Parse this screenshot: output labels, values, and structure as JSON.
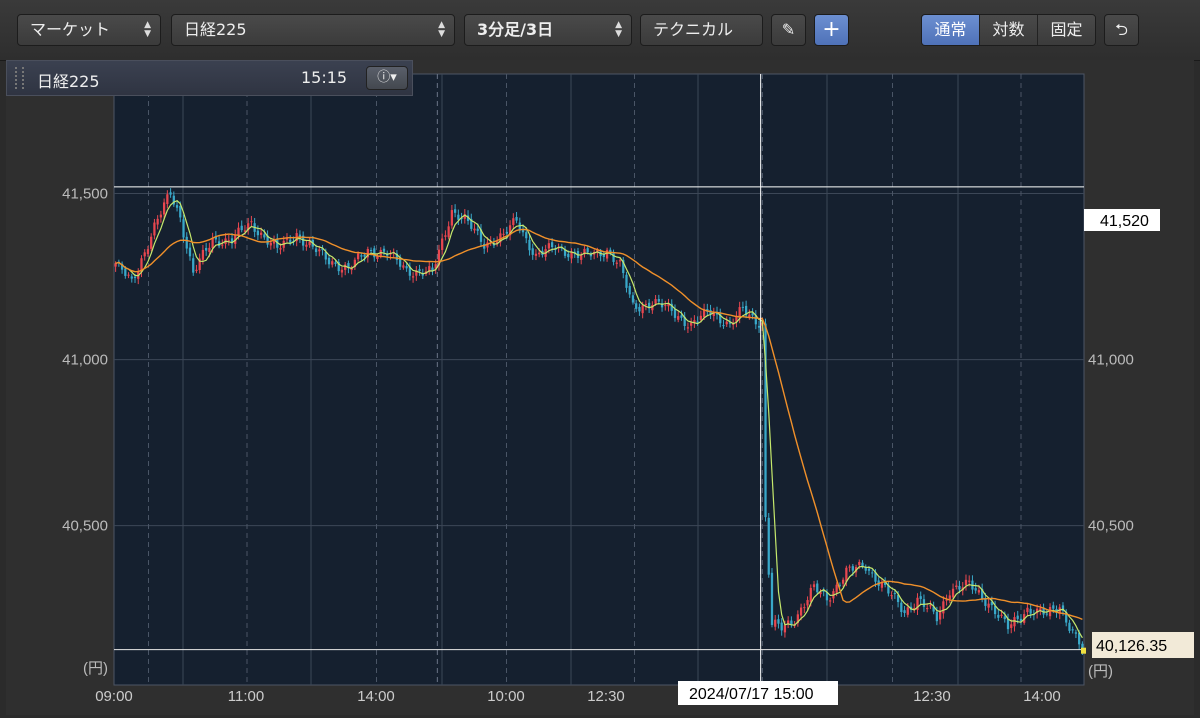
{
  "toolbar": {
    "market_label": "マーケット",
    "symbol_label": "日経225",
    "interval_label": "3分足/3日",
    "technical_label": "テクニカル",
    "scale_modes": [
      "通常",
      "対数",
      "固定"
    ],
    "active_scale_mode": "通常"
  },
  "info_panel": {
    "symbol": "日経225",
    "time": "15:15"
  },
  "crosshair": {
    "date_label": "2024/07/17 15:00",
    "price_label": "41,520",
    "price": 41520
  },
  "last_price": {
    "label": "40,126.35",
    "value": 40126.35
  },
  "unit_label": "(円)",
  "colors": {
    "background": "#15202f",
    "up": "#e8474f",
    "down": "#39a8c9",
    "ma_short": "#c5e86c",
    "ma_long": "#f0902a",
    "crosshair": "#ffffff",
    "last_marker": "#f0e040"
  },
  "chart_data": {
    "type": "candlestick",
    "title": "",
    "ylabel": "(円)",
    "ylim": [
      40020,
      41860
    ],
    "y_ticks": [
      41500,
      41000,
      40500
    ],
    "y_tick_labels": [
      "41,500",
      "41,000",
      "40,500"
    ],
    "x_tick_labels": [
      "09:00",
      "11:00",
      "14:00",
      "10:00",
      "12:30",
      "14:00",
      "10:00",
      "12:30",
      "14:00"
    ],
    "grid": true,
    "n_bars": 300,
    "session_boundaries": [
      100,
      200
    ],
    "crosshair_bar": 200,
    "series": [
      {
        "name": "",
        "kind": "ma_short"
      },
      {
        "name": "",
        "kind": "ma_long"
      }
    ],
    "close_keypoints": [
      [
        0,
        41290
      ],
      [
        5,
        41230
      ],
      [
        12,
        41400
      ],
      [
        17,
        41500
      ],
      [
        20,
        41430
      ],
      [
        24,
        41260
      ],
      [
        30,
        41360
      ],
      [
        36,
        41360
      ],
      [
        42,
        41410
      ],
      [
        50,
        41330
      ],
      [
        56,
        41380
      ],
      [
        60,
        41340
      ],
      [
        66,
        41300
      ],
      [
        72,
        41270
      ],
      [
        78,
        41330
      ],
      [
        84,
        41320
      ],
      [
        90,
        41270
      ],
      [
        98,
        41260
      ],
      [
        104,
        41450
      ],
      [
        108,
        41420
      ],
      [
        114,
        41350
      ],
      [
        120,
        41370
      ],
      [
        124,
        41420
      ],
      [
        130,
        41310
      ],
      [
        136,
        41340
      ],
      [
        144,
        41310
      ],
      [
        152,
        41330
      ],
      [
        156,
        41280
      ],
      [
        160,
        41160
      ],
      [
        166,
        41170
      ],
      [
        172,
        41150
      ],
      [
        178,
        41100
      ],
      [
        184,
        41150
      ],
      [
        190,
        41100
      ],
      [
        194,
        41150
      ],
      [
        198,
        41120
      ],
      [
        200,
        41110
      ],
      [
        201,
        40520
      ],
      [
        203,
        40200
      ],
      [
        206,
        40190
      ],
      [
        210,
        40220
      ],
      [
        216,
        40310
      ],
      [
        220,
        40280
      ],
      [
        226,
        40360
      ],
      [
        232,
        40380
      ],
      [
        238,
        40310
      ],
      [
        244,
        40240
      ],
      [
        248,
        40280
      ],
      [
        254,
        40220
      ],
      [
        258,
        40310
      ],
      [
        264,
        40320
      ],
      [
        270,
        40270
      ],
      [
        276,
        40190
      ],
      [
        282,
        40250
      ],
      [
        288,
        40230
      ],
      [
        292,
        40260
      ],
      [
        296,
        40180
      ],
      [
        299,
        40126.35
      ]
    ]
  }
}
